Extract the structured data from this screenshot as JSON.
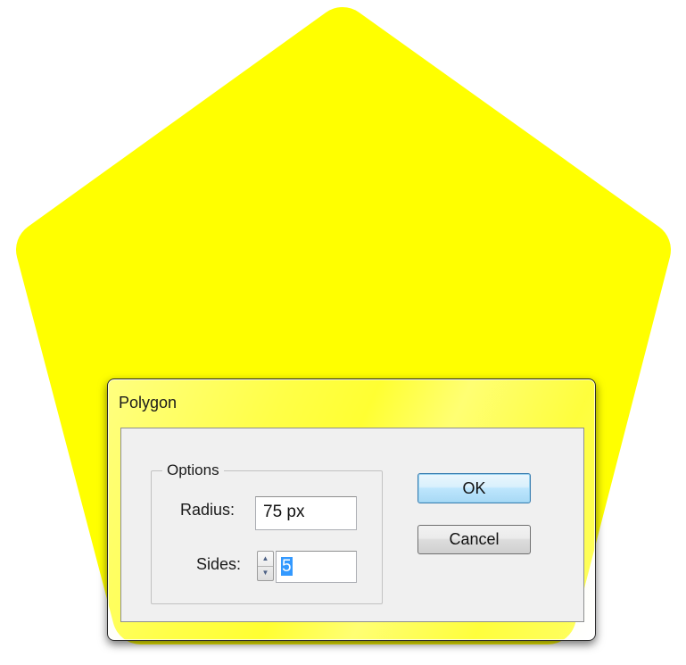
{
  "canvas": {
    "shape": "pentagon",
    "fill_color": "#ffff00"
  },
  "dialog": {
    "title": "Polygon",
    "options_group": {
      "legend": "Options",
      "radius_label": "Radius:",
      "radius_value": "75 px",
      "sides_label": "Sides:",
      "sides_value": "5",
      "sides_spinner_up_icon": "spin-up-arrow-icon",
      "sides_spinner_down_icon": "spin-down-arrow-icon"
    },
    "ok_label": "OK",
    "cancel_label": "Cancel",
    "accent_color": "#3399ff"
  }
}
